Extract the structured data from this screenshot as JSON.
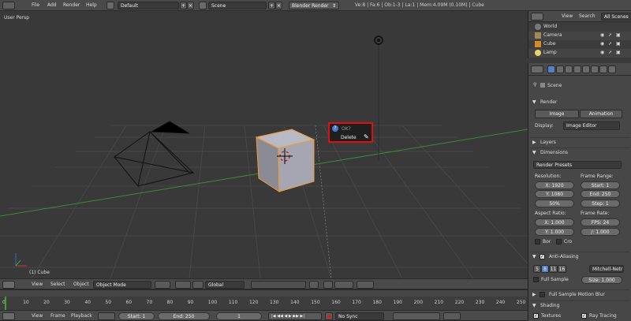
{
  "top_bar": {
    "menu": [
      "File",
      "Add",
      "Render",
      "Help"
    ],
    "layout": "Default",
    "scene": "Scene",
    "engine": "Blender Render",
    "stats": "Ve:8 | Fa:6 | Ob:1-3 | La:1 | Mem:4.09M (0.10M) | Cube"
  },
  "viewport": {
    "view_label": "User Persp",
    "object_label": "(1) Cube"
  },
  "popup": {
    "title": "OK?",
    "action": "Delete"
  },
  "outliner": {
    "menu": [
      "View",
      "Search"
    ],
    "filter": "All Scenes",
    "items": [
      "World",
      "Camera",
      "Cube",
      "Lamp"
    ]
  },
  "properties": {
    "breadcrumb": "Scene",
    "render": {
      "header": "Render",
      "image_btn": "Image",
      "anim_btn": "Animation",
      "display_label": "Display:",
      "display_value": "Image Editor"
    },
    "layers_header": "Layers",
    "dimensions": {
      "header": "Dimensions",
      "presets": "Render Presets",
      "resolution_label": "Resolution:",
      "res_x": "X: 1920",
      "res_y": "Y: 1080",
      "res_pct": "50%",
      "frame_range_label": "Frame Range:",
      "start": "Start: 1",
      "end": "End: 250",
      "step": "Step: 1",
      "aspect_label": "Aspect Ratio:",
      "asp_x": "X: 1.000",
      "asp_y": "Y: 1.000",
      "frame_rate_label": "Frame Rate:",
      "fps": "FPS: 24",
      "fps_base": "/: 1.000",
      "bor": "Bor",
      "cro": "Cro"
    },
    "aa": {
      "header": "Anti-Aliasing",
      "samples": [
        "5",
        "8",
        "11",
        "16"
      ],
      "filter": "Mitchell-Netr",
      "full_sample": "Full Sample",
      "size": "Size: 1.000"
    },
    "motion_blur": "Full Sample Motion Blur",
    "shading": {
      "header": "Shading",
      "textures": "Textures",
      "ray_tracing": "Ray Tracing"
    }
  },
  "view3d_header": {
    "menu": [
      "View",
      "Select",
      "Object"
    ],
    "mode": "Object Mode",
    "orientation": "Global"
  },
  "timeline": {
    "ticks": [
      "0",
      "10",
      "20",
      "30",
      "40",
      "50",
      "60",
      "70",
      "80",
      "90",
      "100",
      "110",
      "120",
      "130",
      "140",
      "150",
      "160",
      "170",
      "180",
      "190",
      "200",
      "210",
      "220",
      "230",
      "240",
      "250"
    ],
    "menu": [
      "View",
      "Frame",
      "Playback"
    ],
    "start": "Start: 1",
    "end": "End: 250",
    "current": "1",
    "sync": "No Sync"
  }
}
